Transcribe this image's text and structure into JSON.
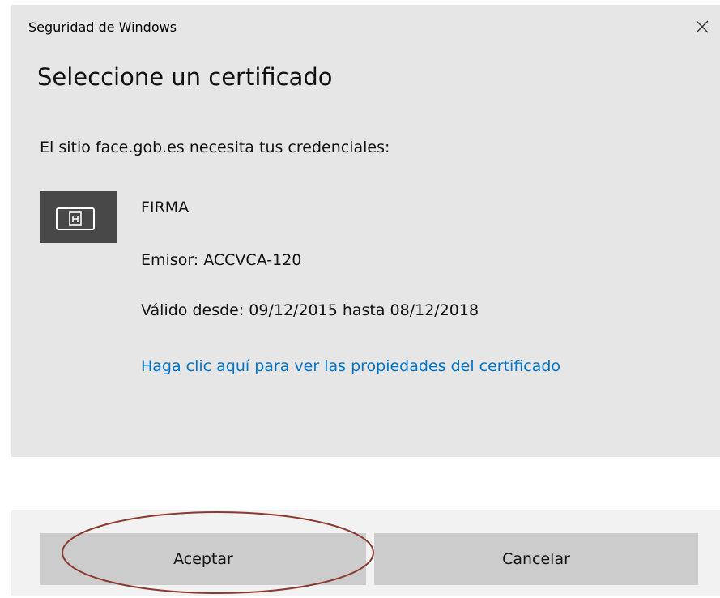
{
  "window": {
    "title": "Seguridad de Windows",
    "close_icon": "close-icon"
  },
  "dialog": {
    "heading": "Seleccione un certificado",
    "description": "El sitio face.gob.es necesita tus credenciales:"
  },
  "certificate": {
    "icon": "certificate-card-icon",
    "name": "FIRMA",
    "issuer": "Emisor: ACCVCA-120",
    "validity": "Válido desde: 09/12/2015 hasta 08/12/2018",
    "properties_link": "Haga clic aquí para ver las propiedades del certificado"
  },
  "buttons": {
    "accept_label": "Aceptar",
    "cancel_label": "Cancelar"
  },
  "colors": {
    "dialog_background": "#e6e6e6",
    "button_background": "#cccccc",
    "link": "#0073c6",
    "tile": "#484848",
    "annotation": "#8b3a2e"
  }
}
